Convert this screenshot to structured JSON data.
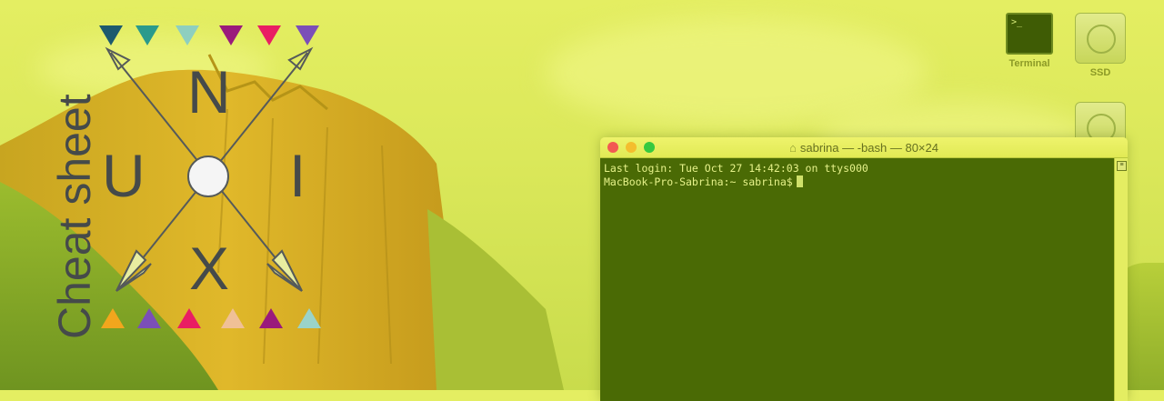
{
  "logo": {
    "side_text": "Cheat sheet",
    "letters": {
      "top": "N",
      "left": "U",
      "right": "I",
      "bottom": "X"
    },
    "top_triangles": [
      "#1d5a6e",
      "#2a9a8c",
      "#8ecfbf",
      "#9a1a7c",
      "#e91e63",
      "#7b4fb8"
    ],
    "bottom_triangles": [
      "#f2a61d",
      "#7b4fb8",
      "#e91e63",
      "#f0c096",
      "#9a1a7c",
      "#9ad3c8"
    ]
  },
  "desktop_icons": [
    {
      "label": "Terminal",
      "icon": "terminal-app-icon",
      "glyph": ">_"
    },
    {
      "label": "SSD",
      "icon": "hard-drive-icon"
    },
    {
      "label": "",
      "icon": "hard-drive-icon"
    }
  ],
  "terminal": {
    "title": "sabrina — -bash — 80×24",
    "lines": [
      "Last login: Tue Oct 27 14:42:03 on ttys000",
      "MacBook-Pro-Sabrina:~ sabrina$"
    ],
    "traffic_lights": {
      "close": "#f25a52",
      "minimize": "#f4be2e",
      "zoom": "#36c93f"
    }
  }
}
